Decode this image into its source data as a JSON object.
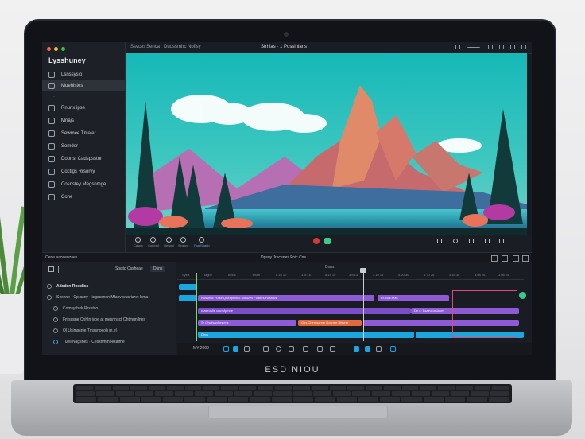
{
  "device": {
    "brand": "ESDINIOU"
  },
  "app": {
    "sidebar": {
      "title": "Lysshuney",
      "items": [
        {
          "label": "Lsnssyslo",
          "icon": "home-icon"
        },
        {
          "label": "Muehistes",
          "icon": "grid-icon"
        },
        {
          "label": "Rnunx ipse",
          "icon": "globe-icon"
        },
        {
          "label": "Mnajs",
          "icon": "folder-icon"
        },
        {
          "label": "Sewmee Tmajer",
          "icon": "image-icon"
        },
        {
          "label": "Somder",
          "icon": "audio-icon"
        },
        {
          "label": "Doonst Cadspsstor",
          "icon": "settings-icon"
        },
        {
          "label": "Coctigs Rrsorvy",
          "icon": "effects-icon"
        },
        {
          "label": "Cosnstey Megsnmge",
          "icon": "text-icon"
        },
        {
          "label": "Cone",
          "icon": "export-icon"
        }
      ]
    },
    "topbar": {
      "left_items": [
        "Ssvces",
        "Senca",
        "Duossmhc Nofisy"
      ],
      "center": "Strhias · 1 Posslnlans"
    },
    "preview_toolbar": [
      "Caspa",
      "Conexd",
      "Oewad",
      "Sinenx",
      "Foa Snanb"
    ],
    "timeline": {
      "header_left": "Cene eaosenzaes",
      "header_center": "Dpsny Jrecenes Fnic Cns",
      "title": "Dsns",
      "ruler": [
        "Syea",
        "Iagne",
        "6etoc",
        "Yotan",
        "8.16 10",
        "3.ct 16",
        "8.19 10",
        "3.tt 13",
        "3.10 13",
        "5.20 30",
        "6.70 26",
        "3.16 36",
        "3.08 26",
        "3.06 25"
      ],
      "layers_header": "Sissto Cssheae",
      "layers_group": "Adsden Roscllss",
      "layers": [
        "Sesnne · Cprasny · isgascnon Mfacv wusriaret lkma",
        "Comsyrh rk Rrsetso",
        "Fmsgsne Cnhtn ivoe at mesrtnsct Ohtmunllnes",
        "Ol Usimssnie Tmssnoeoh m.el",
        "Tueil Nagsnes · Cessnmmeesaime"
      ],
      "clips": [
        {
          "label": "Nussenc Frase Qheapsimlo Soruzes Foaees.Hostnus"
        },
        {
          "label": "P.t.bu Ereas"
        },
        {
          "label": "ntaseuslle uncrsfpmne"
        },
        {
          "label": "De e· Bsaeopaslaues"
        },
        {
          "label": "Sr Gtsolsanhesleris"
        },
        {
          "label": "Qirs Cherssonne Oosrme Bhkeer"
        },
        {
          "label": "Dhcs"
        }
      ],
      "bottom_time": "MY 2000"
    }
  },
  "colors": {
    "accent": "#8f5ad6",
    "track_blue": "#1aa7e0",
    "highlight": "#e14b7a"
  }
}
